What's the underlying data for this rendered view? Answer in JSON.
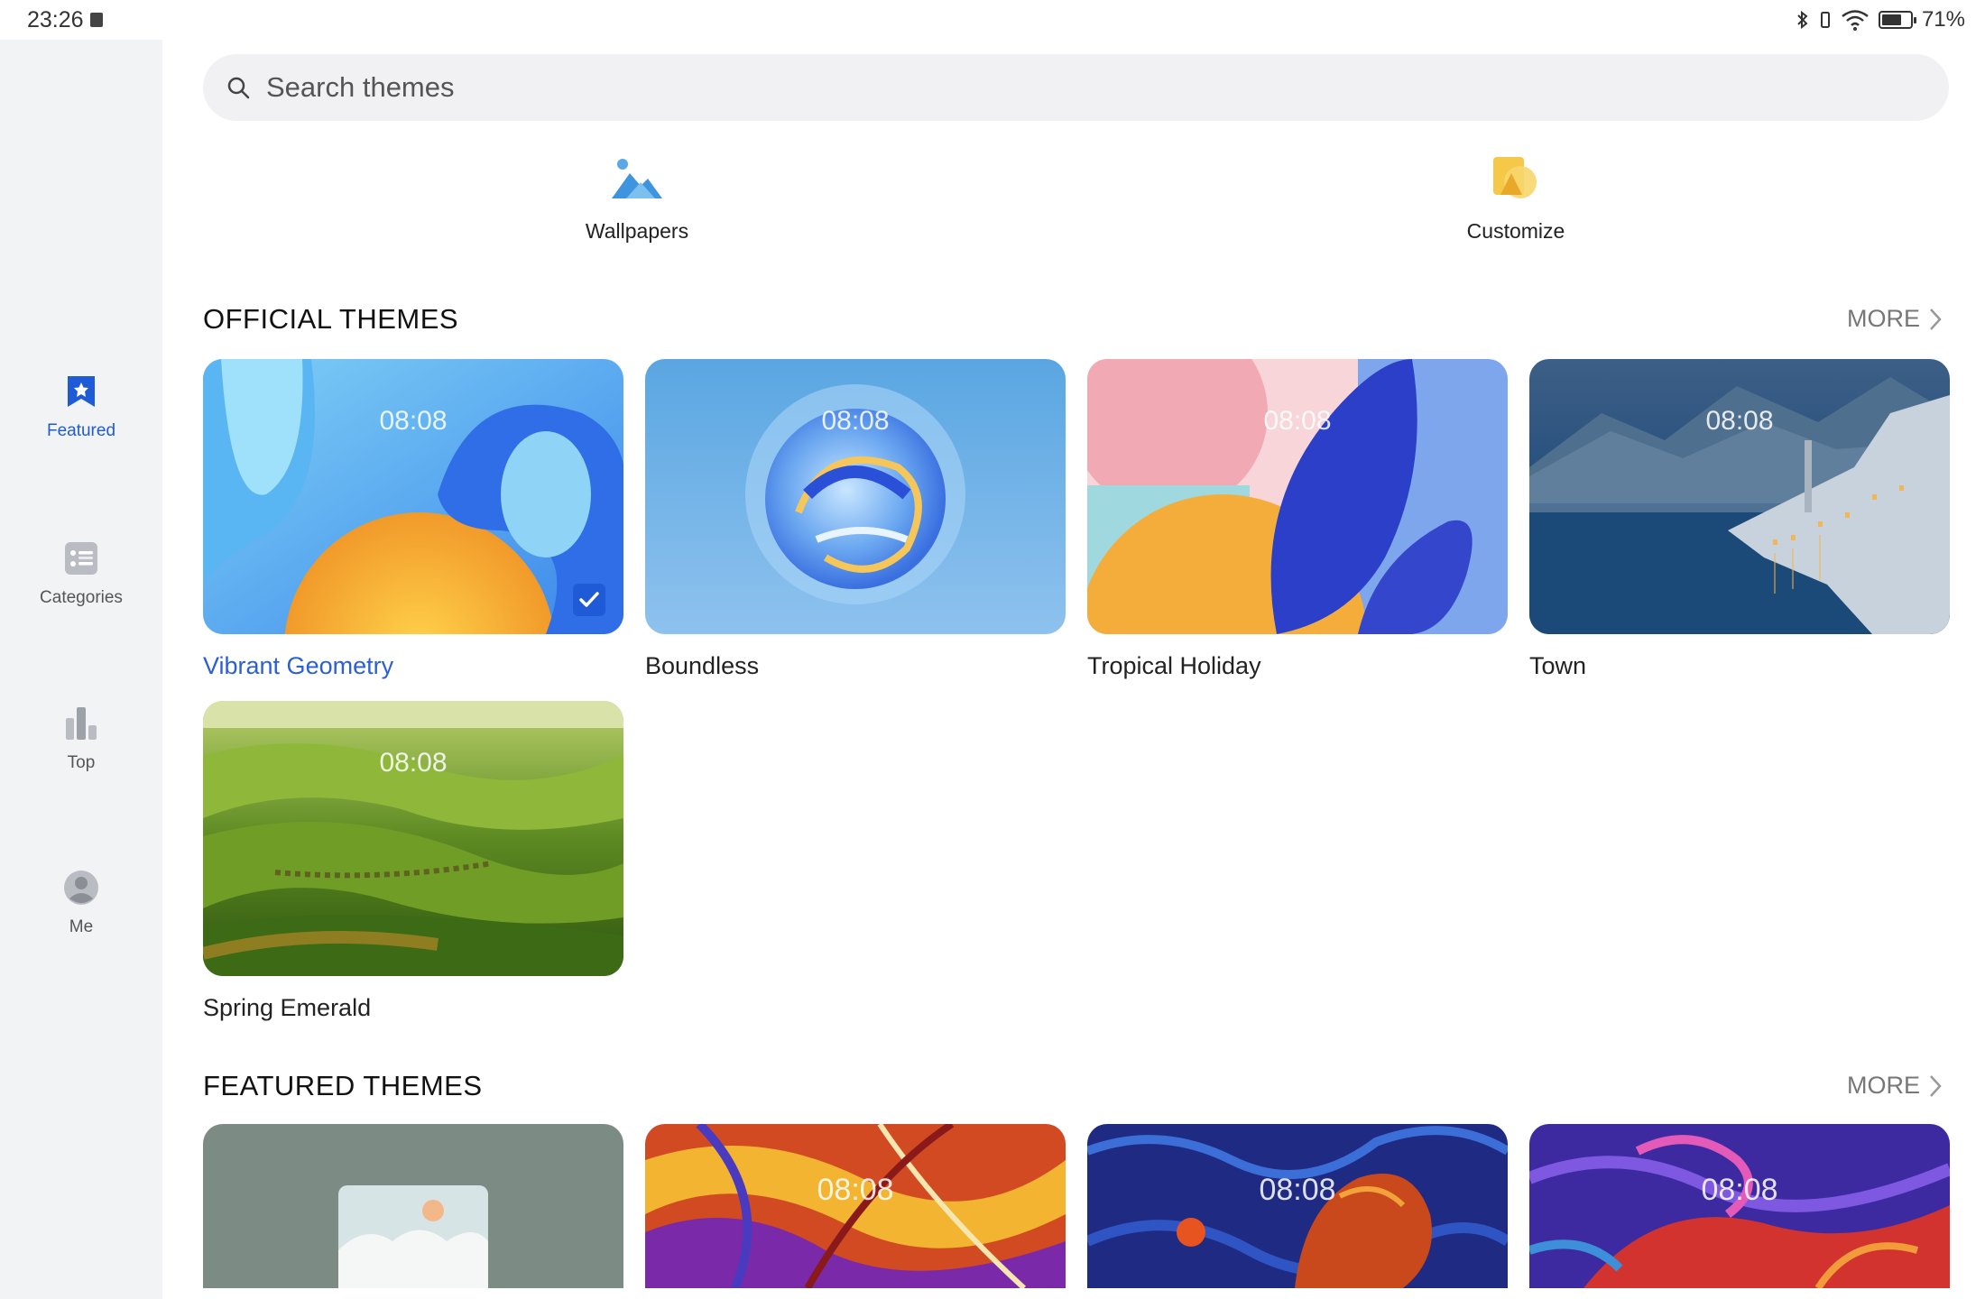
{
  "status_bar": {
    "time": "23:26",
    "battery": "71%",
    "battery_level": 0.71
  },
  "sidebar": {
    "items": [
      {
        "label": "Featured",
        "active": true
      },
      {
        "label": "Categories",
        "active": false
      },
      {
        "label": "Top",
        "active": false
      },
      {
        "label": "Me",
        "active": false
      }
    ]
  },
  "search": {
    "placeholder": "Search themes"
  },
  "shortcuts": [
    {
      "label": "Wallpapers"
    },
    {
      "label": "Customize"
    }
  ],
  "official": {
    "title": "OFFICIAL THEMES",
    "more": "MORE",
    "themes": [
      {
        "name": "Vibrant Geometry",
        "clock": "08:08",
        "selected": true
      },
      {
        "name": "Boundless",
        "clock": "08:08",
        "selected": false
      },
      {
        "name": "Tropical Holiday",
        "clock": "08:08",
        "selected": false
      },
      {
        "name": "Town",
        "clock": "08:08",
        "selected": false
      },
      {
        "name": "Spring Emerald",
        "clock": "08:08",
        "selected": false
      }
    ]
  },
  "featured": {
    "title": "FEATURED THEMES",
    "more": "MORE",
    "clocks": [
      "",
      "08:08",
      "08:08",
      "08:08"
    ]
  },
  "colors": {
    "accent": "#1f5bd6",
    "sidebar_bg": "#f2f3f5",
    "search_bg": "#f1f1f3"
  }
}
